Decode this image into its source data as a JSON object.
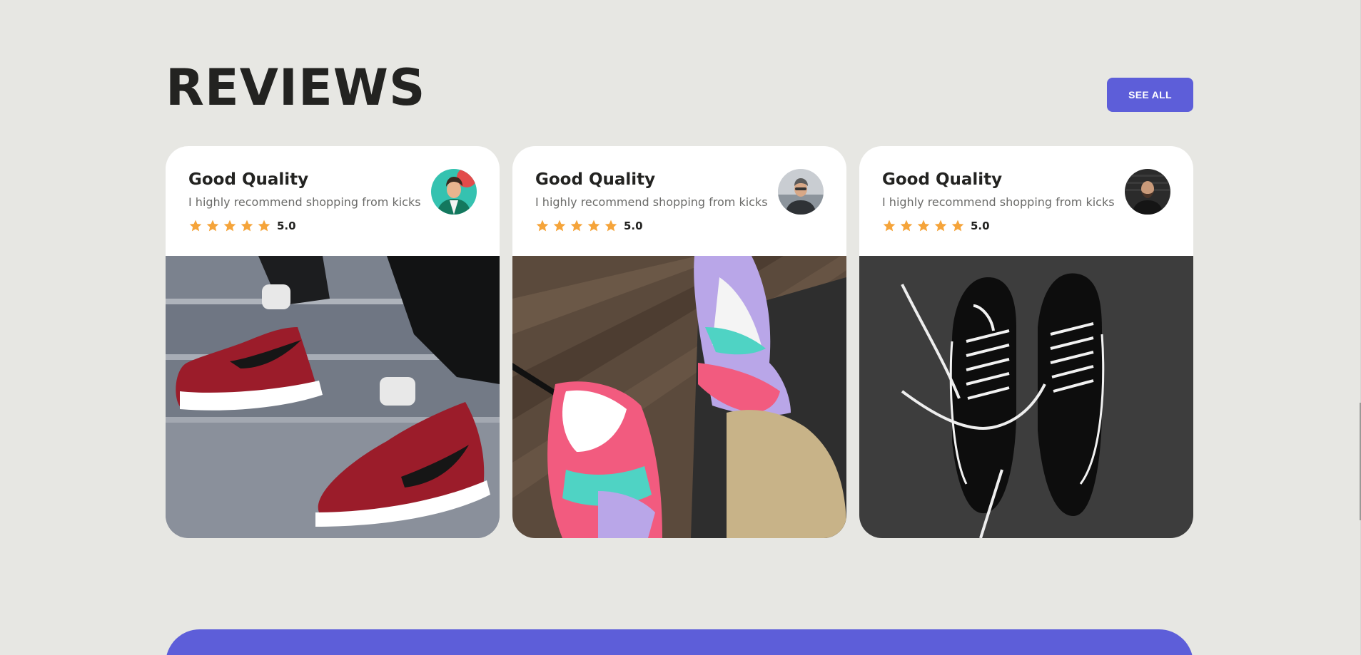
{
  "section": {
    "title": "REVIEWS",
    "see_all_label": "SEE ALL"
  },
  "colors": {
    "background": "#e7e7e3",
    "accent": "#5d5ed9",
    "star": "#f5a43a",
    "card": "#ffffff",
    "heading": "#232321"
  },
  "reviews": [
    {
      "title": "Good Quality",
      "text": "I highly recommend shopping from kicks",
      "stars": 5,
      "rating": "5.0",
      "avatar_icon": "reviewer-avatar-teal",
      "photo_icon": "red-white-high-top-sneakers-photo"
    },
    {
      "title": "Good Quality",
      "text": "I highly recommend shopping from kicks",
      "stars": 5,
      "rating": "5.0",
      "avatar_icon": "reviewer-avatar-grey",
      "photo_icon": "pastel-multicolor-sneakers-photo"
    },
    {
      "title": "Good Quality",
      "text": "I highly recommend shopping from kicks",
      "stars": 5,
      "rating": "5.0",
      "avatar_icon": "reviewer-avatar-dark",
      "photo_icon": "black-suede-sneakers-photo"
    }
  ]
}
